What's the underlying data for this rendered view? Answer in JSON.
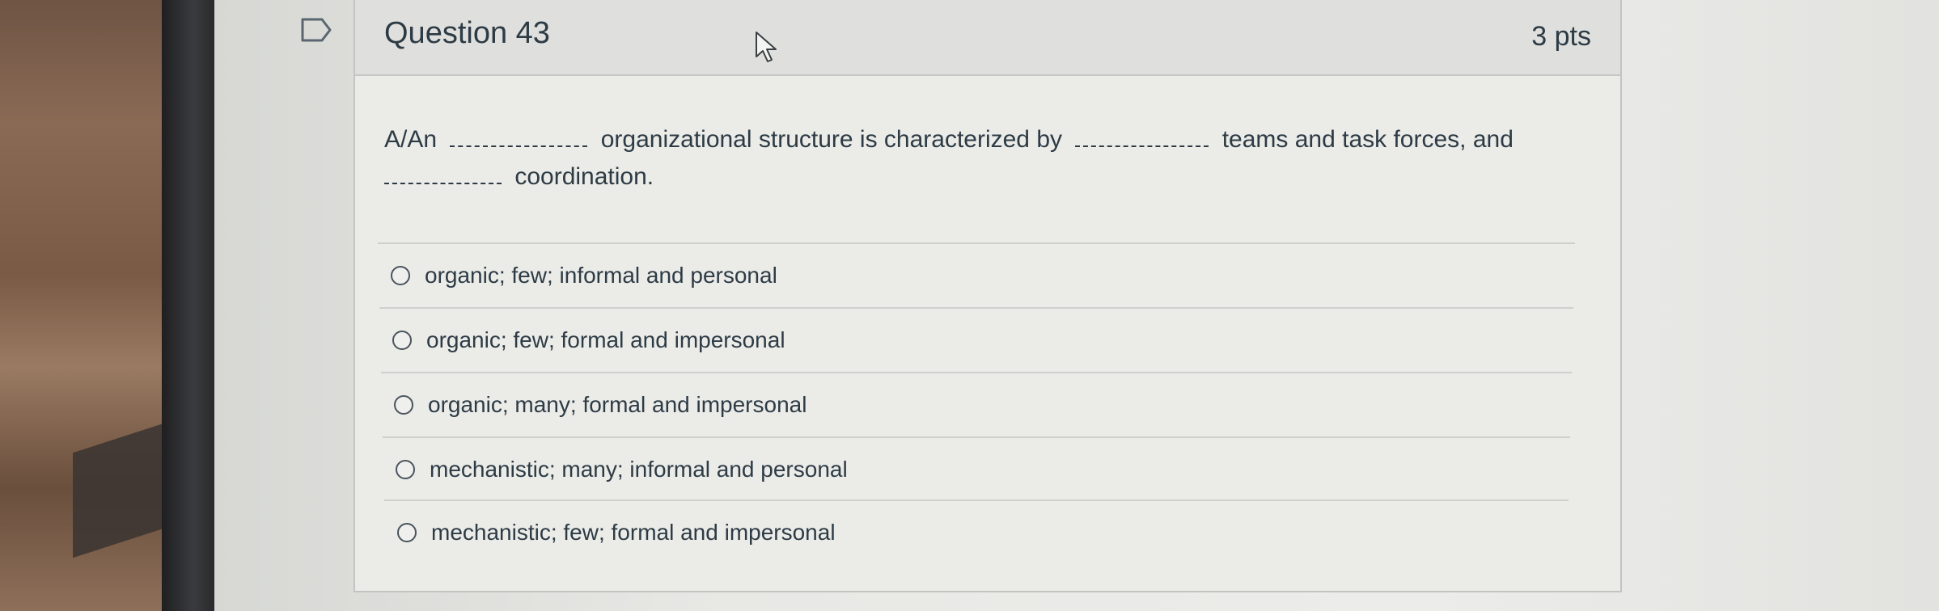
{
  "question": {
    "title": "Question 43",
    "points": "3 pts",
    "text_part1": "A/An",
    "text_part2": "organizational structure is characterized by",
    "text_part3": "teams and task forces, and",
    "text_part4": "coordination."
  },
  "answers": [
    {
      "label": "organic; few; informal and personal"
    },
    {
      "label": "organic; few; formal and impersonal"
    },
    {
      "label": "organic; many; formal and impersonal"
    },
    {
      "label": "mechanistic; many; informal and personal"
    },
    {
      "label": "mechanistic; few; formal and impersonal"
    }
  ],
  "icons": {
    "flag": "flag-question-icon",
    "cursor": "mouse-pointer-icon",
    "radio": "radio-button-icon"
  },
  "colors": {
    "text": "#2d3b45",
    "header_bg": "#dfe0dd",
    "card_bg": "#ebebe8"
  }
}
